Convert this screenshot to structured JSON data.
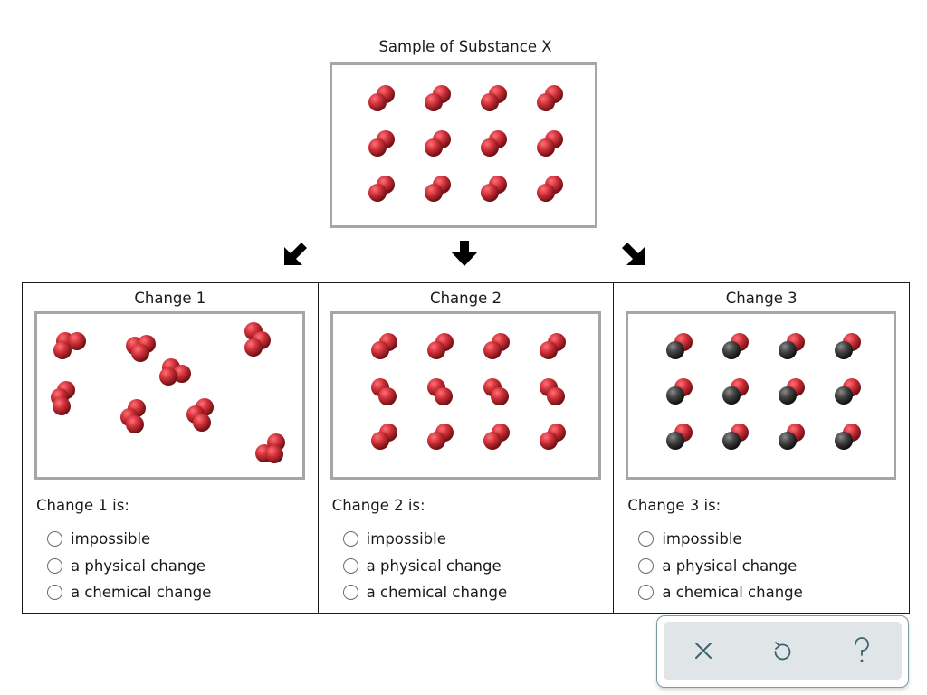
{
  "sample": {
    "title": "Sample of Substance X",
    "molecule": "diatomic-red",
    "count": 12
  },
  "arrows": [
    "arrow-down-left",
    "arrow-down",
    "arrow-down-right"
  ],
  "changes": [
    {
      "title": "Change 1",
      "question": "Change 1 is:",
      "molecule": "triatomic-red",
      "count": 8,
      "options": [
        "impossible",
        "a physical change",
        "a chemical change"
      ]
    },
    {
      "title": "Change 2",
      "question": "Change 2 is:",
      "molecule": "diatomic-red",
      "count": 12,
      "options": [
        "impossible",
        "a physical change",
        "a chemical change"
      ]
    },
    {
      "title": "Change 3",
      "question": "Change 3 is:",
      "molecule": "diatomic-black-red",
      "count": 12,
      "options": [
        "impossible",
        "a physical change",
        "a chemical change"
      ]
    }
  ],
  "toolbar": {
    "close_label": "×",
    "undo_label": "undo",
    "help_label": "?"
  },
  "colors": {
    "red_atom": "#c0282e",
    "black_atom": "#3a3a3a",
    "box_border": "#a6a6a6",
    "toolbar_bg": "#e0e6e8",
    "toolbar_icon": "#3d6470"
  }
}
